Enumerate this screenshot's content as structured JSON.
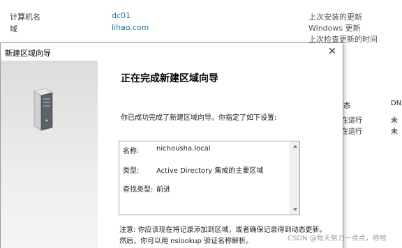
{
  "background": {
    "properties": [
      {
        "label": "计算机名",
        "value": "dc01"
      },
      {
        "label": "域",
        "value": "lihao.com"
      }
    ],
    "right_labels": [
      "上次安装的更新",
      "Windows 更新",
      "上次检查更新的时间"
    ],
    "table": {
      "headers": [
        "态",
        "DN"
      ],
      "rows": [
        [
          "在运行",
          "未"
        ],
        [
          "在运行",
          "未"
        ]
      ]
    }
  },
  "dialog": {
    "title": "新建区域向导",
    "close_glyph": "✕",
    "heading": "正在完成新建区域向导",
    "description": "你已成功完成了新建区域向导。你指定了如下设置:",
    "settings": [
      {
        "label": "名称:",
        "value": "nichousha.local"
      },
      {
        "label": "类型:",
        "value": "Active Directory 集成的主要区域"
      },
      {
        "label": "查找类型:",
        "value": "前进"
      }
    ],
    "note": "注意: 你应该现在将记录添加到区域，或者确保记录得到动态更新。然后，你可以用 nslookup 验证名称解析。"
  },
  "watermark": "CSDN @每天努力一点点，哈哈"
}
